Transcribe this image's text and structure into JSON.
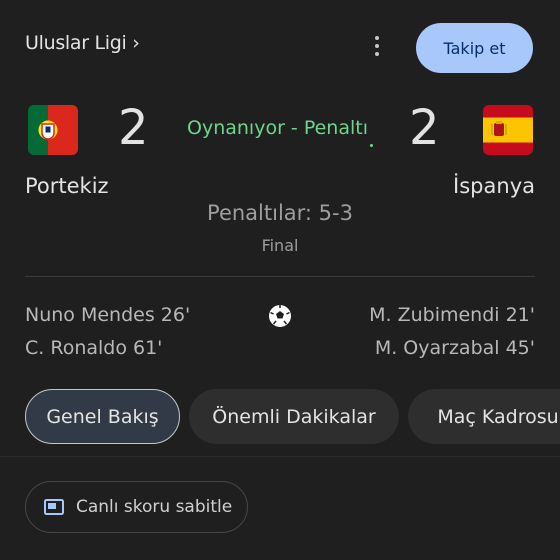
{
  "header": {
    "league": "Uluslar Ligi ›",
    "follow_label": "Takip et",
    "more_icon": "more-vert-icon"
  },
  "match": {
    "status": "Oynanıyor - Penaltı",
    "penalties": "Penaltılar: 5-3",
    "result": "Final",
    "home": {
      "name": "Portekiz",
      "score": "2",
      "flag_icon": "portugal-flag-icon",
      "scorers": [
        "Nuno Mendes 26'",
        "C. Ronaldo 61'"
      ]
    },
    "away": {
      "name": "İspanya",
      "score": "2",
      "flag_icon": "spain-flag-icon",
      "scorers": [
        "M. Zubimendi 21'",
        "M. Oyarzabal 45'"
      ]
    }
  },
  "tabs": [
    {
      "label": "Genel Bakış",
      "selected": true
    },
    {
      "label": "Önemli Dakikalar",
      "selected": false
    },
    {
      "label": "Maç Kadrosu",
      "selected": false
    }
  ],
  "pin_button": {
    "label": "Canlı skoru sabitle",
    "icon": "picture-in-picture-icon"
  },
  "colors": {
    "background": "#1f1f1f",
    "status_green": "#6dd58c",
    "follow_bg": "#a8c7fa",
    "selected_tab_bg": "#333a47"
  }
}
